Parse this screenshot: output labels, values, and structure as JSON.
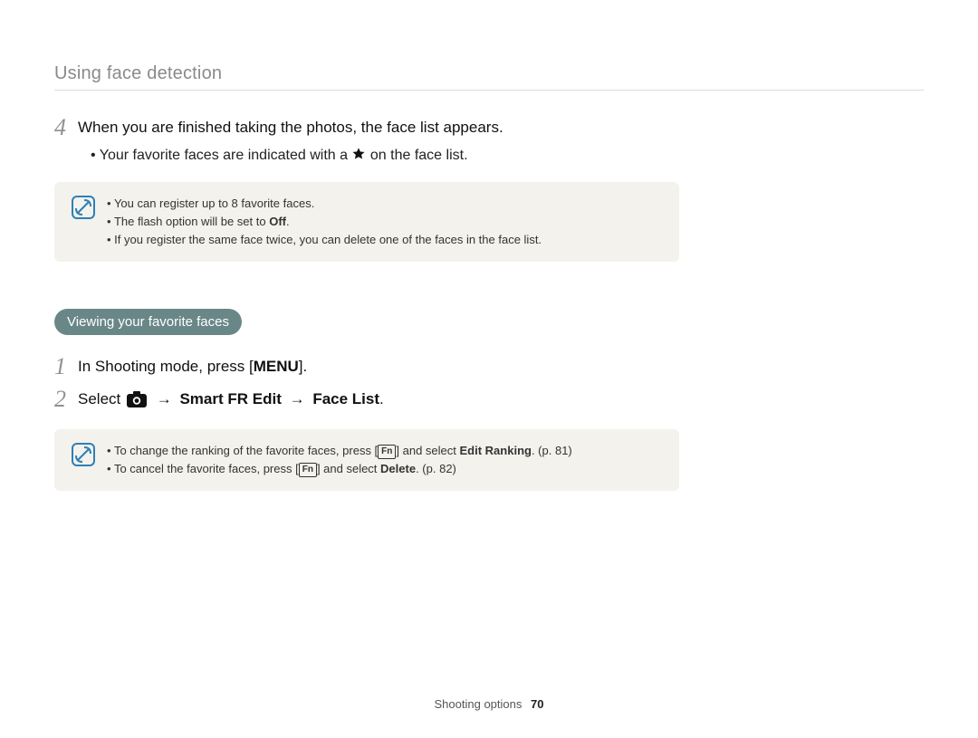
{
  "header": {
    "title": "Using face detection"
  },
  "step4": {
    "num": "4",
    "text": "When you are finished taking the photos, the face list appears.",
    "bullet_pre": "Your favorite faces are indicated with a",
    "bullet_post": "on the face list."
  },
  "note1": {
    "items": [
      {
        "text_pre": "You can register up to 8 favorite faces."
      },
      {
        "text_pre": "The flash option will be set to ",
        "bold": "Off",
        "text_post": "."
      },
      {
        "text_pre": "If you register the same face twice, you can delete one of the faces in the face list."
      }
    ]
  },
  "section": {
    "title": "Viewing your favorite faces"
  },
  "step1": {
    "num": "1",
    "text_pre": "In Shooting mode, press [",
    "button": "MENU",
    "text_post": "]."
  },
  "step2": {
    "num": "2",
    "text_pre": "Select",
    "arrow": "→",
    "path1": "Smart FR Edit",
    "path2": "Face List",
    "period": "."
  },
  "note2": {
    "items": [
      {
        "pre": "To change the ranking of the favorite faces, press [",
        "fn": "Fn",
        "mid": "] and select ",
        "bold": "Edit Ranking",
        "post": ". (p. 81)"
      },
      {
        "pre": "To cancel the favorite faces, press [",
        "fn": "Fn",
        "mid": "] and select ",
        "bold": "Delete",
        "post": ". (p. 82)"
      }
    ]
  },
  "footer": {
    "section": "Shooting options",
    "page": "70"
  }
}
